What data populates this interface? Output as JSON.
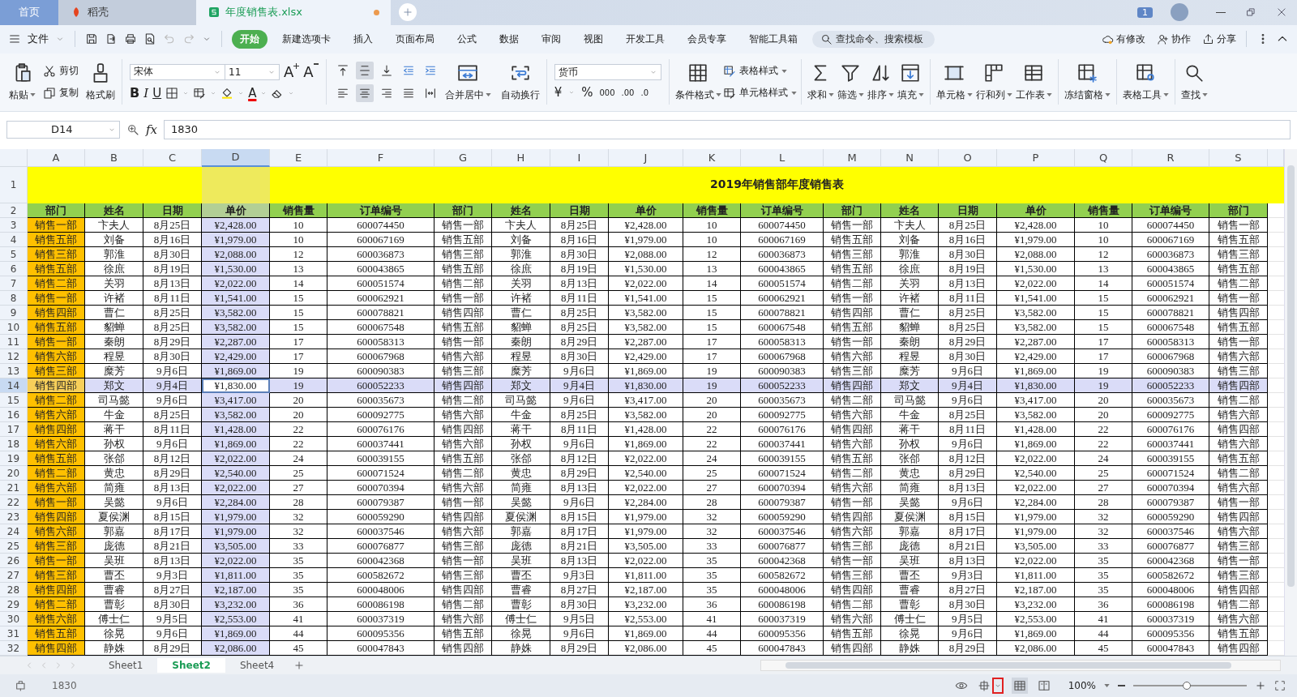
{
  "tabs": [
    {
      "label": "首页",
      "kind": "home",
      "selected": false,
      "modified": false
    },
    {
      "label": "稻壳",
      "kind": "docer",
      "selected": false,
      "modified": false
    },
    {
      "label": "年度销售表.xlsx",
      "kind": "sheet",
      "selected": true,
      "modified": true
    }
  ],
  "notifications": {
    "count": "1"
  },
  "menu": {
    "file": "文件",
    "undo": {
      "disabled": true
    },
    "redo": {
      "disabled": true
    },
    "items": [
      {
        "label": "开始",
        "selected": true
      },
      {
        "label": "新建选项卡",
        "selected": false
      },
      {
        "label": "插入",
        "selected": false
      },
      {
        "label": "页面布局",
        "selected": false
      },
      {
        "label": "公式",
        "selected": false
      },
      {
        "label": "数据",
        "selected": false
      },
      {
        "label": "审阅",
        "selected": false
      },
      {
        "label": "视图",
        "selected": false
      },
      {
        "label": "开发工具",
        "selected": false
      },
      {
        "label": "会员专享",
        "selected": false
      },
      {
        "label": "智能工具箱",
        "selected": false
      }
    ],
    "search": {
      "placeholder": "查找命令、搜索模板"
    },
    "actions": [
      "有修改",
      "协作",
      "分享"
    ]
  },
  "ribbon": {
    "clipboard": {
      "paste": "粘贴",
      "cut": "剪切",
      "copy": "复制",
      "format_painter": "格式刷"
    },
    "font": {
      "name": "宋体",
      "size": "11",
      "grow": "A",
      "shrink": "A",
      "bold": "B",
      "italic": "I",
      "underline": "U",
      "font_color_button": "A"
    },
    "alignment": {
      "vertical": [
        {
          "selected": false
        },
        {
          "selected": true
        },
        {
          "selected": false
        }
      ],
      "horizontal": [
        {
          "selected": false
        },
        {
          "selected": true
        },
        {
          "selected": false
        },
        {
          "selected": false
        }
      ],
      "merge": "合并居中",
      "wrap": "自动换行"
    },
    "number": {
      "format": "货币",
      "currency": "¥",
      "percent": "%",
      "thousands": "000",
      "add_decimal": ".00",
      "remove_decimal": ".0"
    },
    "tools": [
      {
        "kind": "large",
        "label": "条件格式"
      },
      {
        "kind": "stack",
        "items": [
          "表格样式",
          "单元格样式"
        ]
      },
      {
        "kind": "large",
        "label": "求和"
      },
      {
        "kind": "large",
        "label": "筛选"
      },
      {
        "kind": "large",
        "label": "排序"
      },
      {
        "kind": "large",
        "label": "填充"
      },
      {
        "kind": "large",
        "label": "单元格"
      },
      {
        "kind": "large",
        "label": "行和列"
      },
      {
        "kind": "large",
        "label": "工作表"
      },
      {
        "kind": "large",
        "label": "冻结窗格"
      },
      {
        "kind": "large",
        "label": "表格工具"
      },
      {
        "kind": "large",
        "label": "查找"
      }
    ]
  },
  "formula_bar": {
    "name_box": "D14",
    "fx": "fx",
    "value": "1830"
  },
  "sheet": {
    "columns": [
      {
        "letter": "A",
        "selected": false,
        "kind": "highlighted"
      },
      {
        "letter": "B",
        "selected": false,
        "kind": "plain"
      },
      {
        "letter": "C",
        "selected": false,
        "kind": "plain"
      },
      {
        "letter": "D",
        "selected": true,
        "kind": "plain"
      },
      {
        "letter": "E",
        "selected": false,
        "kind": "plain"
      },
      {
        "letter": "F",
        "selected": false,
        "kind": "plain"
      },
      {
        "letter": "G",
        "selected": false,
        "kind": "plain"
      },
      {
        "letter": "H",
        "selected": false,
        "kind": "plain"
      },
      {
        "letter": "I",
        "selected": false,
        "kind": "plain"
      },
      {
        "letter": "J",
        "selected": false,
        "kind": "plain"
      },
      {
        "letter": "K",
        "selected": false,
        "kind": "plain"
      },
      {
        "letter": "L",
        "selected": false,
        "kind": "plain"
      },
      {
        "letter": "M",
        "selected": false,
        "kind": "plain"
      },
      {
        "letter": "N",
        "selected": false,
        "kind": "plain"
      },
      {
        "letter": "O",
        "selected": false,
        "kind": "plain"
      },
      {
        "letter": "P",
        "selected": false,
        "kind": "plain"
      },
      {
        "letter": "Q",
        "selected": false,
        "kind": "plain"
      },
      {
        "letter": "R",
        "selected": false,
        "kind": "plain"
      },
      {
        "letter": "S",
        "selected": false,
        "kind": "plain"
      }
    ],
    "title_row": "1",
    "title": "2019年销售部年度销售表",
    "header_row": "2",
    "header": [
      "部门",
      "姓名",
      "日期",
      "单价",
      "销售量",
      "订单编号",
      "部门",
      "姓名",
      "日期",
      "单价",
      "销售量",
      "订单编号",
      "部门",
      "姓名",
      "日期",
      "单价",
      "销售量",
      "订单编号",
      "部门"
    ],
    "rows": [
      {
        "number": "3",
        "selected": false,
        "cells": [
          "销售一部",
          "卞夫人",
          "8月25日",
          "¥2,428.00",
          "10",
          "600074450",
          "销售一部",
          "卞夫人",
          "8月25日",
          "¥2,428.00",
          "10",
          "600074450",
          "销售一部",
          "卞夫人",
          "8月25日",
          "¥2,428.00",
          "10",
          "600074450",
          "销售一部"
        ]
      },
      {
        "number": "4",
        "selected": false,
        "cells": [
          "销售五部",
          "刘备",
          "8月16日",
          "¥1,979.00",
          "10",
          "600067169",
          "销售五部",
          "刘备",
          "8月16日",
          "¥1,979.00",
          "10",
          "600067169",
          "销售五部",
          "刘备",
          "8月16日",
          "¥1,979.00",
          "10",
          "600067169",
          "销售五部"
        ]
      },
      {
        "number": "5",
        "selected": false,
        "cells": [
          "销售三部",
          "郭淮",
          "8月30日",
          "¥2,088.00",
          "12",
          "600036873",
          "销售三部",
          "郭淮",
          "8月30日",
          "¥2,088.00",
          "12",
          "600036873",
          "销售三部",
          "郭淮",
          "8月30日",
          "¥2,088.00",
          "12",
          "600036873",
          "销售三部"
        ]
      },
      {
        "number": "6",
        "selected": false,
        "cells": [
          "销售五部",
          "徐庶",
          "8月19日",
          "¥1,530.00",
          "13",
          "600043865",
          "销售五部",
          "徐庶",
          "8月19日",
          "¥1,530.00",
          "13",
          "600043865",
          "销售五部",
          "徐庶",
          "8月19日",
          "¥1,530.00",
          "13",
          "600043865",
          "销售五部"
        ]
      },
      {
        "number": "7",
        "selected": false,
        "cells": [
          "销售二部",
          "关羽",
          "8月13日",
          "¥2,022.00",
          "14",
          "600051574",
          "销售二部",
          "关羽",
          "8月13日",
          "¥2,022.00",
          "14",
          "600051574",
          "销售二部",
          "关羽",
          "8月13日",
          "¥2,022.00",
          "14",
          "600051574",
          "销售二部"
        ]
      },
      {
        "number": "8",
        "selected": false,
        "cells": [
          "销售一部",
          "许褚",
          "8月11日",
          "¥1,541.00",
          "15",
          "600062921",
          "销售一部",
          "许褚",
          "8月11日",
          "¥1,541.00",
          "15",
          "600062921",
          "销售一部",
          "许褚",
          "8月11日",
          "¥1,541.00",
          "15",
          "600062921",
          "销售一部"
        ]
      },
      {
        "number": "9",
        "selected": false,
        "cells": [
          "销售四部",
          "曹仁",
          "8月25日",
          "¥3,582.00",
          "15",
          "600078821",
          "销售四部",
          "曹仁",
          "8月25日",
          "¥3,582.00",
          "15",
          "600078821",
          "销售四部",
          "曹仁",
          "8月25日",
          "¥3,582.00",
          "15",
          "600078821",
          "销售四部"
        ]
      },
      {
        "number": "10",
        "selected": false,
        "cells": [
          "销售五部",
          "貂蝉",
          "8月25日",
          "¥3,582.00",
          "15",
          "600067548",
          "销售五部",
          "貂蝉",
          "8月25日",
          "¥3,582.00",
          "15",
          "600067548",
          "销售五部",
          "貂蝉",
          "8月25日",
          "¥3,582.00",
          "15",
          "600067548",
          "销售五部"
        ]
      },
      {
        "number": "11",
        "selected": false,
        "cells": [
          "销售一部",
          "秦朗",
          "8月29日",
          "¥2,287.00",
          "17",
          "600058313",
          "销售一部",
          "秦朗",
          "8月29日",
          "¥2,287.00",
          "17",
          "600058313",
          "销售一部",
          "秦朗",
          "8月29日",
          "¥2,287.00",
          "17",
          "600058313",
          "销售一部"
        ]
      },
      {
        "number": "12",
        "selected": false,
        "cells": [
          "销售六部",
          "程昱",
          "8月30日",
          "¥2,429.00",
          "17",
          "600067968",
          "销售六部",
          "程昱",
          "8月30日",
          "¥2,429.00",
          "17",
          "600067968",
          "销售六部",
          "程昱",
          "8月30日",
          "¥2,429.00",
          "17",
          "600067968",
          "销售六部"
        ]
      },
      {
        "number": "13",
        "selected": false,
        "cells": [
          "销售三部",
          "糜芳",
          "9月6日",
          "¥1,869.00",
          "19",
          "600090383",
          "销售三部",
          "糜芳",
          "9月6日",
          "¥1,869.00",
          "19",
          "600090383",
          "销售三部",
          "糜芳",
          "9月6日",
          "¥1,869.00",
          "19",
          "600090383",
          "销售三部"
        ]
      },
      {
        "number": "14",
        "selected": true,
        "cells": [
          "销售四部",
          "郑文",
          "9月4日",
          "¥1,830.00",
          "19",
          "600052233",
          "销售四部",
          "郑文",
          "9月4日",
          "¥1,830.00",
          "19",
          "600052233",
          "销售四部",
          "郑文",
          "9月4日",
          "¥1,830.00",
          "19",
          "600052233",
          "销售四部"
        ]
      },
      {
        "number": "15",
        "selected": false,
        "cells": [
          "销售二部",
          "司马懿",
          "9月6日",
          "¥3,417.00",
          "20",
          "600035673",
          "销售二部",
          "司马懿",
          "9月6日",
          "¥3,417.00",
          "20",
          "600035673",
          "销售二部",
          "司马懿",
          "9月6日",
          "¥3,417.00",
          "20",
          "600035673",
          "销售二部"
        ]
      },
      {
        "number": "16",
        "selected": false,
        "cells": [
          "销售六部",
          "牛金",
          "8月25日",
          "¥3,582.00",
          "20",
          "600092775",
          "销售六部",
          "牛金",
          "8月25日",
          "¥3,582.00",
          "20",
          "600092775",
          "销售六部",
          "牛金",
          "8月25日",
          "¥3,582.00",
          "20",
          "600092775",
          "销售六部"
        ]
      },
      {
        "number": "17",
        "selected": false,
        "cells": [
          "销售四部",
          "蒋干",
          "8月11日",
          "¥1,428.00",
          "22",
          "600076176",
          "销售四部",
          "蒋干",
          "8月11日",
          "¥1,428.00",
          "22",
          "600076176",
          "销售四部",
          "蒋干",
          "8月11日",
          "¥1,428.00",
          "22",
          "600076176",
          "销售四部"
        ]
      },
      {
        "number": "18",
        "selected": false,
        "cells": [
          "销售六部",
          "孙权",
          "9月6日",
          "¥1,869.00",
          "22",
          "600037441",
          "销售六部",
          "孙权",
          "9月6日",
          "¥1,869.00",
          "22",
          "600037441",
          "销售六部",
          "孙权",
          "9月6日",
          "¥1,869.00",
          "22",
          "600037441",
          "销售六部"
        ]
      },
      {
        "number": "19",
        "selected": false,
        "cells": [
          "销售五部",
          "张郃",
          "8月12日",
          "¥2,022.00",
          "24",
          "600039155",
          "销售五部",
          "张郃",
          "8月12日",
          "¥2,022.00",
          "24",
          "600039155",
          "销售五部",
          "张郃",
          "8月12日",
          "¥2,022.00",
          "24",
          "600039155",
          "销售五部"
        ]
      },
      {
        "number": "20",
        "selected": false,
        "cells": [
          "销售二部",
          "黄忠",
          "8月29日",
          "¥2,540.00",
          "25",
          "600071524",
          "销售二部",
          "黄忠",
          "8月29日",
          "¥2,540.00",
          "25",
          "600071524",
          "销售二部",
          "黄忠",
          "8月29日",
          "¥2,540.00",
          "25",
          "600071524",
          "销售二部"
        ]
      },
      {
        "number": "21",
        "selected": false,
        "cells": [
          "销售六部",
          "简雍",
          "8月13日",
          "¥2,022.00",
          "27",
          "600070394",
          "销售六部",
          "简雍",
          "8月13日",
          "¥2,022.00",
          "27",
          "600070394",
          "销售六部",
          "简雍",
          "8月13日",
          "¥2,022.00",
          "27",
          "600070394",
          "销售六部"
        ]
      },
      {
        "number": "22",
        "selected": false,
        "cells": [
          "销售一部",
          "吴懿",
          "9月6日",
          "¥2,284.00",
          "28",
          "600079387",
          "销售一部",
          "吴懿",
          "9月6日",
          "¥2,284.00",
          "28",
          "600079387",
          "销售一部",
          "吴懿",
          "9月6日",
          "¥2,284.00",
          "28",
          "600079387",
          "销售一部"
        ]
      },
      {
        "number": "23",
        "selected": false,
        "cells": [
          "销售四部",
          "夏侯渊",
          "8月15日",
          "¥1,979.00",
          "32",
          "600059290",
          "销售四部",
          "夏侯渊",
          "8月15日",
          "¥1,979.00",
          "32",
          "600059290",
          "销售四部",
          "夏侯渊",
          "8月15日",
          "¥1,979.00",
          "32",
          "600059290",
          "销售四部"
        ]
      },
      {
        "number": "24",
        "selected": false,
        "cells": [
          "销售六部",
          "郭嘉",
          "8月17日",
          "¥1,979.00",
          "32",
          "600037546",
          "销售六部",
          "郭嘉",
          "8月17日",
          "¥1,979.00",
          "32",
          "600037546",
          "销售六部",
          "郭嘉",
          "8月17日",
          "¥1,979.00",
          "32",
          "600037546",
          "销售六部"
        ]
      },
      {
        "number": "25",
        "selected": false,
        "cells": [
          "销售三部",
          "庞德",
          "8月21日",
          "¥3,505.00",
          "33",
          "600076877",
          "销售三部",
          "庞德",
          "8月21日",
          "¥3,505.00",
          "33",
          "600076877",
          "销售三部",
          "庞德",
          "8月21日",
          "¥3,505.00",
          "33",
          "600076877",
          "销售三部"
        ]
      },
      {
        "number": "26",
        "selected": false,
        "cells": [
          "销售一部",
          "吴班",
          "8月13日",
          "¥2,022.00",
          "35",
          "600042368",
          "销售一部",
          "吴班",
          "8月13日",
          "¥2,022.00",
          "35",
          "600042368",
          "销售一部",
          "吴班",
          "8月13日",
          "¥2,022.00",
          "35",
          "600042368",
          "销售一部"
        ]
      },
      {
        "number": "27",
        "selected": false,
        "cells": [
          "销售三部",
          "曹丕",
          "9月3日",
          "¥1,811.00",
          "35",
          "600582672",
          "销售三部",
          "曹丕",
          "9月3日",
          "¥1,811.00",
          "35",
          "600582672",
          "销售三部",
          "曹丕",
          "9月3日",
          "¥1,811.00",
          "35",
          "600582672",
          "销售三部"
        ]
      },
      {
        "number": "28",
        "selected": false,
        "cells": [
          "销售四部",
          "曹睿",
          "8月27日",
          "¥2,187.00",
          "35",
          "600048006",
          "销售四部",
          "曹睿",
          "8月27日",
          "¥2,187.00",
          "35",
          "600048006",
          "销售四部",
          "曹睿",
          "8月27日",
          "¥2,187.00",
          "35",
          "600048006",
          "销售四部"
        ]
      },
      {
        "number": "29",
        "selected": false,
        "cells": [
          "销售二部",
          "曹彰",
          "8月30日",
          "¥3,232.00",
          "36",
          "600086198",
          "销售二部",
          "曹彰",
          "8月30日",
          "¥3,232.00",
          "36",
          "600086198",
          "销售二部",
          "曹彰",
          "8月30日",
          "¥3,232.00",
          "36",
          "600086198",
          "销售二部"
        ]
      },
      {
        "number": "30",
        "selected": false,
        "cells": [
          "销售六部",
          "傅士仁",
          "9月5日",
          "¥2,553.00",
          "41",
          "600037319",
          "销售六部",
          "傅士仁",
          "9月5日",
          "¥2,553.00",
          "41",
          "600037319",
          "销售六部",
          "傅士仁",
          "9月5日",
          "¥2,553.00",
          "41",
          "600037319",
          "销售六部"
        ]
      },
      {
        "number": "31",
        "selected": false,
        "cells": [
          "销售五部",
          "徐晃",
          "9月6日",
          "¥1,869.00",
          "44",
          "600095356",
          "销售五部",
          "徐晃",
          "9月6日",
          "¥1,869.00",
          "44",
          "600095356",
          "销售五部",
          "徐晃",
          "9月6日",
          "¥1,869.00",
          "44",
          "600095356",
          "销售五部"
        ]
      },
      {
        "number": "32",
        "selected": false,
        "cells": [
          "销售四部",
          "静姝",
          "8月29日",
          "¥2,086.00",
          "45",
          "600047843",
          "销售四部",
          "静姝",
          "8月29日",
          "¥2,086.00",
          "45",
          "600047843",
          "销售四部",
          "静姝",
          "8月29日",
          "¥2,086.00",
          "45",
          "600047843",
          "销售四部"
        ]
      }
    ]
  },
  "sheet_tabs": [
    {
      "label": "Sheet1",
      "selected": false
    },
    {
      "label": "Sheet2",
      "selected": true
    },
    {
      "label": "Sheet4",
      "selected": false
    }
  ],
  "status_bar": {
    "value": "1830",
    "zoom": "100%",
    "zoom_slider": {
      "level": 0.47
    }
  }
}
